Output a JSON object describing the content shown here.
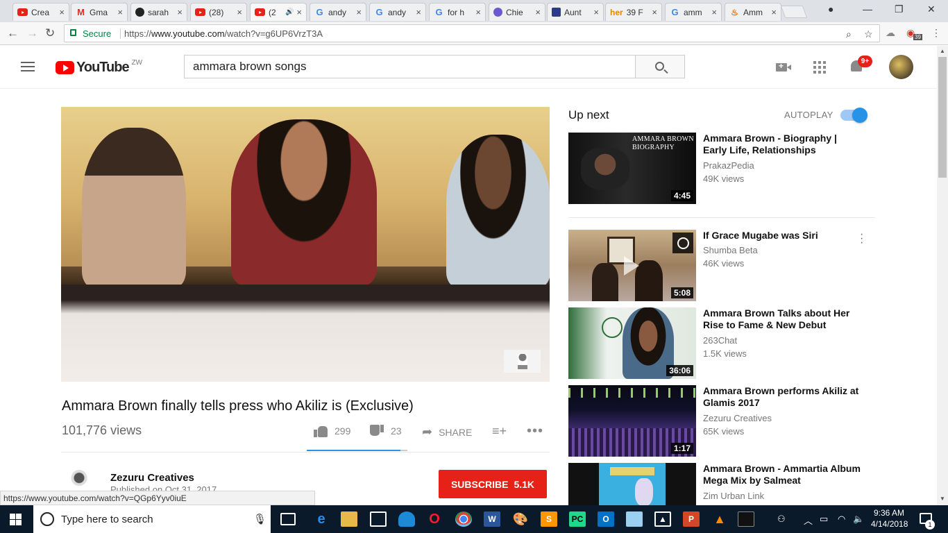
{
  "browser": {
    "tabs": [
      {
        "label": "Crea",
        "favicon": "youtube-favicon"
      },
      {
        "label": "Gma",
        "favicon": "gmail-favicon"
      },
      {
        "label": "sarah",
        "favicon": "github-favicon"
      },
      {
        "label": "(28) ",
        "favicon": "youtube-favicon"
      },
      {
        "label": "(2",
        "favicon": "youtube-favicon",
        "active": true,
        "audio": true
      },
      {
        "label": "andy",
        "favicon": "google-favicon"
      },
      {
        "label": "andy",
        "favicon": "google-favicon"
      },
      {
        "label": "for h",
        "favicon": "google-favicon"
      },
      {
        "label": "Chie",
        "favicon": "chief-favicon"
      },
      {
        "label": "Aunt",
        "favicon": "s-favicon"
      },
      {
        "label": "39 F",
        "favicon": "her-favicon"
      },
      {
        "label": "amm",
        "favicon": "google-favicon"
      },
      {
        "label": "Amm",
        "favicon": "fire-favicon"
      }
    ],
    "tab_close_glyph": "×",
    "secure_label": "Secure",
    "url_scheme": "https://",
    "url_host": "www.youtube.com",
    "url_path": "/watch?v=g6UP6VrzT3A",
    "extension_badge": "39",
    "status_bar_url": "https://www.youtube.com/watch?v=QGp6Yyv0iuE"
  },
  "youtube": {
    "logo_text": "YouTube",
    "country_code": "ZW",
    "search_value": "ammara brown songs",
    "notification_count": "9+",
    "accent_color": "#ff0000"
  },
  "video": {
    "title": "Ammara Brown finally tells press who Akiliz is (Exclusive)",
    "views": "101,776 views",
    "likes": "299",
    "dislikes": "23",
    "like_ratio": 0.93,
    "share_label": "SHARE",
    "channel": "Zezuru Creatives",
    "published": "Published on Oct 31, 2017",
    "subscribe_label": "SUBSCRIBE",
    "subscriber_count": "5.1K"
  },
  "sidebar": {
    "up_next_label": "Up next",
    "autoplay_label": "AUTOPLAY",
    "autoplay_on": true,
    "items": [
      {
        "title": "Ammara Brown - Biography | Early Life, Relationships",
        "channel": "PrakazPedia",
        "views": "49K views",
        "duration": "4:45",
        "thumb_text_1": "AMMARA BROWN",
        "thumb_text_2": "BIOGRAPHY"
      },
      {
        "title": "If Grace Mugabe was Siri",
        "channel": "Shumba Beta",
        "views": "46K views",
        "duration": "5:08"
      },
      {
        "title": "Ammara Brown Talks about Her Rise to Fame & New Debut",
        "channel": "263Chat",
        "views": "1.5K views",
        "duration": "36:06"
      },
      {
        "title": "Ammara Brown performs Akiliz at Glamis 2017",
        "channel": "Zezuru Creatives",
        "views": "65K views",
        "duration": "1:17"
      },
      {
        "title": "Ammara Brown - Ammartia Album Mega Mix by Salmeat",
        "channel": "Zim Urban Link",
        "views": "",
        "duration": ""
      }
    ]
  },
  "taskbar": {
    "search_placeholder": "Type here to search",
    "time": "9:36 AM",
    "date": "4/14/2018",
    "notification_count": "1"
  }
}
